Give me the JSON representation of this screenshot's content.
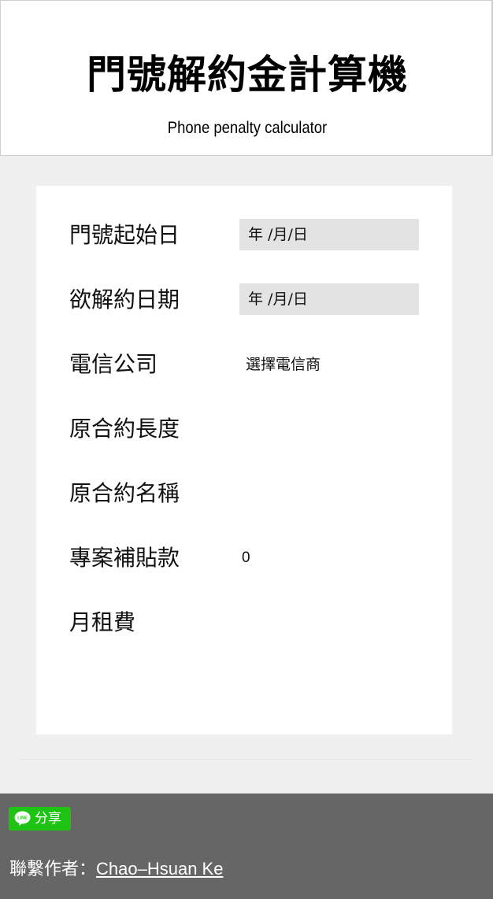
{
  "header": {
    "title": "門號解約金計算機",
    "subtitle": "Phone penalty calculator"
  },
  "form": {
    "start_date": {
      "label": "門號起始日",
      "value": "年 /月/日"
    },
    "end_date": {
      "label": "欲解約日期",
      "value": "年 /月/日"
    },
    "carrier": {
      "label": "電信公司",
      "value": "選擇電信商"
    },
    "contract_length": {
      "label": "原合約長度"
    },
    "contract_name": {
      "label": "原合約名稱"
    },
    "subsidy": {
      "label": "專案補貼款",
      "value": "0"
    },
    "monthly_fee": {
      "label": "月租費"
    }
  },
  "footer": {
    "share_label": "分享",
    "line_icon_text": "LINE",
    "contact_prefix": "聯繫作者：",
    "author_name": "Chao–Hsuan Ke",
    "share_icon": "line-icon",
    "colors": {
      "line_green": "#1ec313",
      "footer_bg": "#666666"
    }
  }
}
